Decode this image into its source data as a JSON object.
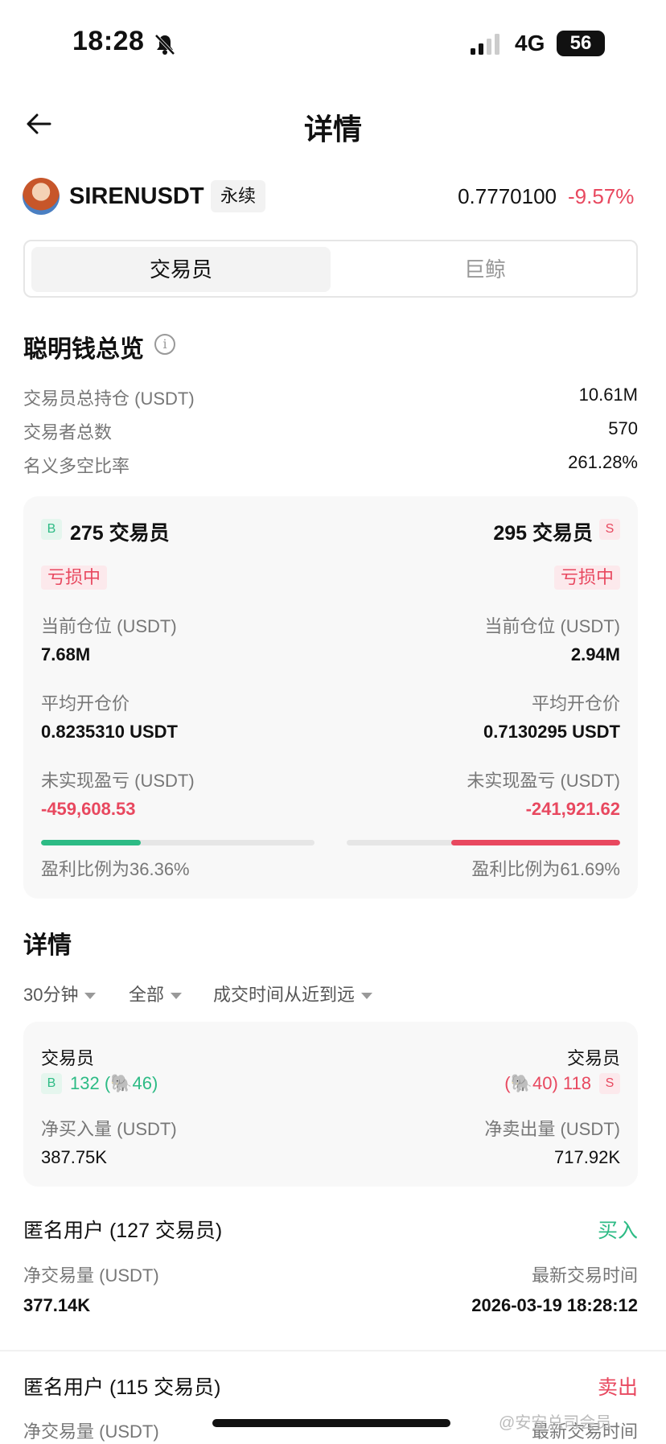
{
  "status_bar": {
    "time": "18:28",
    "network": "4G",
    "battery": "56"
  },
  "header": {
    "title": "详情"
  },
  "ticker": {
    "symbol": "SIRENUSDT",
    "tag": "永续",
    "price": "0.7770100",
    "change": "-9.57%"
  },
  "tabs": [
    {
      "label": "交易员",
      "active": true
    },
    {
      "label": "巨鲸",
      "active": false
    }
  ],
  "overview": {
    "title": "聪明钱总览",
    "rows": [
      {
        "label": "交易员总持仓 (USDT)",
        "value": "10.61M"
      },
      {
        "label": "交易者总数",
        "value": "570"
      },
      {
        "label": "名义多空比率",
        "value": "261.28%"
      }
    ]
  },
  "long": {
    "badge": "B",
    "count_label": "275 交易员",
    "status": "亏损中",
    "position_label": "当前仓位 (USDT)",
    "position": "7.68M",
    "avg_price_label": "平均开仓价",
    "avg_price": "0.8235310 USDT",
    "pnl_label": "未实现盈亏 (USDT)",
    "pnl": "-459,608.53",
    "profit_ratio_text": "盈利比例为36.36%",
    "profit_ratio": 0.3636
  },
  "short": {
    "badge": "S",
    "count_label": "295 交易员",
    "status": "亏损中",
    "position_label": "当前仓位 (USDT)",
    "position": "2.94M",
    "avg_price_label": "平均开仓价",
    "avg_price": "0.7130295 USDT",
    "pnl_label": "未实现盈亏 (USDT)",
    "pnl": "-241,921.62",
    "profit_ratio_text": "盈利比例为61.69%",
    "profit_ratio": 0.6169
  },
  "details": {
    "title": "详情",
    "filters": [
      "30分钟",
      "全部",
      "成交时间从近到远"
    ],
    "summary": {
      "buy_title": "交易员",
      "buy_badge": "B",
      "buy_counts": "132 (🐘46)",
      "sell_title": "交易员",
      "sell_badge": "S",
      "sell_counts": "(🐘40) 118",
      "net_buy_label": "净买入量 (USDT)",
      "net_buy": "387.75K",
      "net_sell_label": "净卖出量 (USDT)",
      "net_sell": "717.92K"
    },
    "trades": [
      {
        "user": "匿名用户 (127 交易员)",
        "side": "买入",
        "volume_label": "净交易量 (USDT)",
        "volume": "377.14K",
        "time_label": "最新交易时间",
        "time": "2026-03-19 18:28:12"
      },
      {
        "user": "匿名用户 (115 交易员)",
        "side": "卖出",
        "volume_label": "净交易量 (USDT)",
        "time_label": "最新交易时间"
      }
    ]
  },
  "watermark": "@安安总司会员",
  "colors": {
    "green": "#2dbb85",
    "red": "#e8485f"
  }
}
